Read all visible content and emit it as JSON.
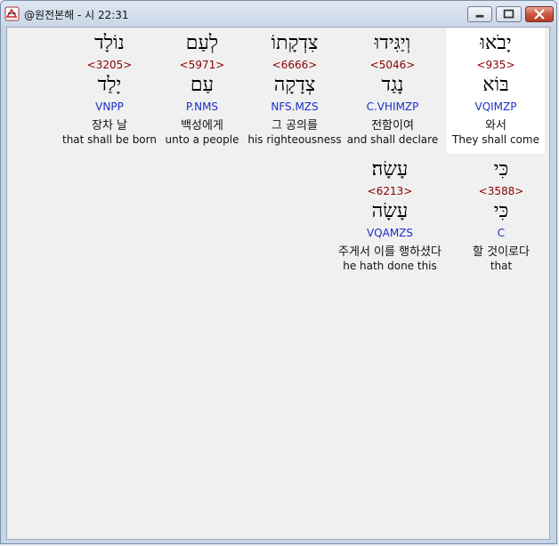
{
  "window": {
    "title": "@원전본해 - 시 22:31"
  },
  "icons": {
    "app": "bible-app-icon",
    "minimize": "minimize-icon",
    "maximize": "maximize-icon",
    "close": "close-icon"
  },
  "words": [
    {
      "hebrew": "יָבֹאוּ",
      "strong": "<935>",
      "root": "בּוֹא",
      "parse": "VQIMZP",
      "korean": "와서",
      "english": "They shall come"
    },
    {
      "hebrew": "וְיַגִּידוּ",
      "strong": "<5046>",
      "root": "נָגַד",
      "parse": "C.VHIMZP",
      "korean": "전함이여",
      "english": "and shall declare"
    },
    {
      "hebrew": "צִדְקָתוֹ",
      "strong": "<6666>",
      "root": "צְדָקָה",
      "parse": "NFS.MZS",
      "korean": "그 공의를",
      "english": "his righteousness"
    },
    {
      "hebrew": "לְעַם",
      "strong": "<5971>",
      "root": "עַם",
      "parse": "P.NMS",
      "korean": "백성에게",
      "english": "unto a people"
    },
    {
      "hebrew": "נוֹלָד",
      "strong": "<3205>",
      "root": "יָלַד",
      "parse": "VNPP",
      "korean": "장차 날",
      "english": "that shall be born"
    },
    {
      "hebrew": "כִּי",
      "strong": "<3588>",
      "root": "כִּי",
      "parse": "C",
      "korean": "할 것이로다",
      "english": "that"
    },
    {
      "hebrew": "עָשָׂה׃",
      "strong": "<6213>",
      "root": "עָשָׂה",
      "parse": "VQAMZS",
      "korean": "주게서 이를 행하셨다",
      "english": "he hath done this"
    }
  ]
}
